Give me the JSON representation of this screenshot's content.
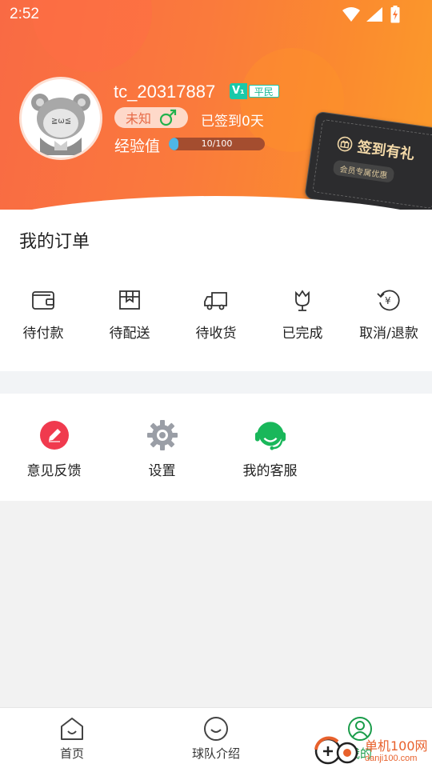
{
  "status_bar": {
    "time": "2:52"
  },
  "profile": {
    "username": "tc_20317887",
    "vip_level": "V₁",
    "rank": "平民",
    "gender": "未知",
    "gender_symbol": "♂",
    "signin_text": "已签到0天",
    "exp_label": "经验值",
    "exp_text": "10/100",
    "exp_fraction": 0.1
  },
  "promo_card": {
    "title": "签到有礼",
    "subtitle": "会员专属优惠"
  },
  "orders": {
    "title": "我的订单",
    "items": [
      {
        "label": "待付款",
        "icon": "wallet-icon"
      },
      {
        "label": "待配送",
        "icon": "box-icon"
      },
      {
        "label": "待收货",
        "icon": "truck-icon"
      },
      {
        "label": "已完成",
        "icon": "tulip-icon"
      },
      {
        "label": "取消/退款",
        "icon": "refund-icon"
      }
    ]
  },
  "services": {
    "items": [
      {
        "label": "意见反馈",
        "icon": "edit-icon",
        "color": "#f03a4e"
      },
      {
        "label": "设置",
        "icon": "gear-icon",
        "color": "#9a9ea6"
      },
      {
        "label": "我的客服",
        "icon": "headset-icon",
        "color": "#19b75a"
      }
    ]
  },
  "bottom_nav": {
    "tabs": [
      {
        "label": "首页",
        "icon": "home-icon",
        "active": false
      },
      {
        "label": "球队介绍",
        "icon": "smile-icon",
        "active": false
      },
      {
        "label": "我的",
        "icon": "user-icon",
        "active": true
      }
    ]
  },
  "watermark": {
    "title": "单机100网",
    "url": "danji100.com"
  },
  "colors": {
    "header_start": "#f96a44",
    "header_end": "#fb9b2a",
    "accent_green": "#1a9c4a",
    "vip_teal": "#19c9a9"
  }
}
